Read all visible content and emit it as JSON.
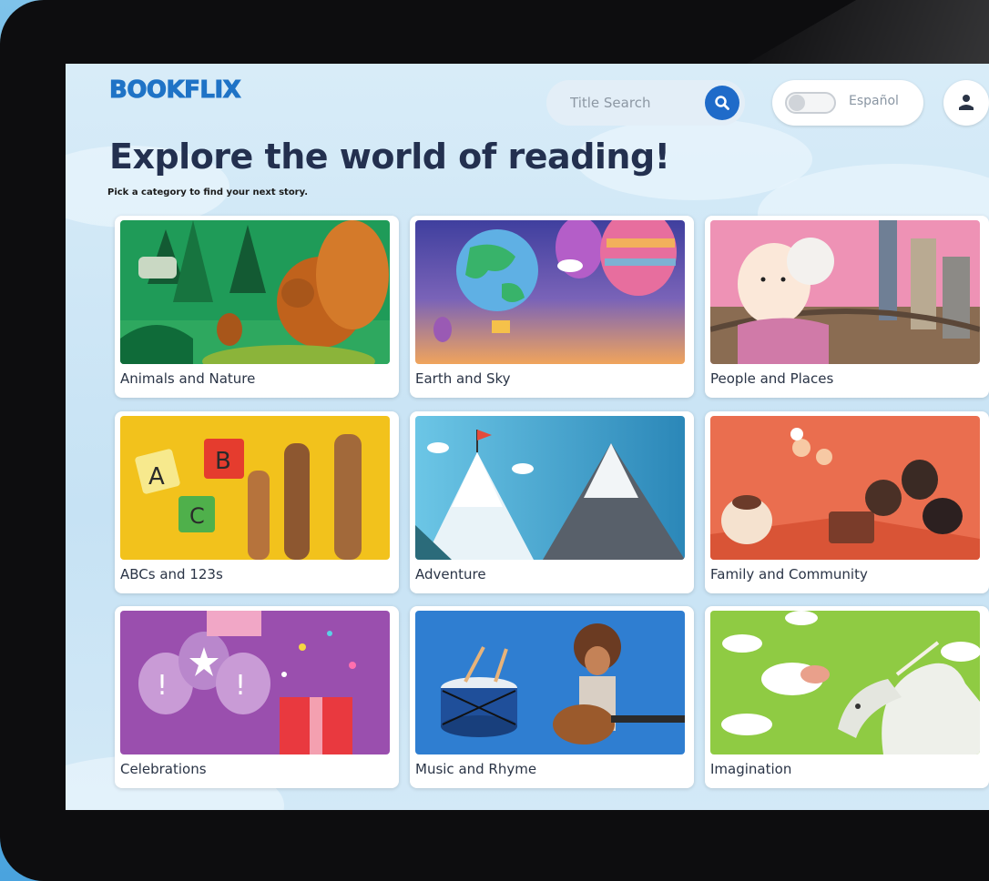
{
  "app": {
    "logo": "BOOKFLIX"
  },
  "header": {
    "search": {
      "placeholder": "Title Search",
      "icon": "search-icon"
    },
    "language_toggle": {
      "label": "Español",
      "state": "off"
    },
    "avatar": {
      "icon": "user-icon"
    }
  },
  "main": {
    "title": "Explore the world of reading!",
    "subtitle": "Pick a category to find your next story."
  },
  "categories": [
    {
      "label": "Animals and Nature"
    },
    {
      "label": "Earth and Sky"
    },
    {
      "label": "People and Places"
    },
    {
      "label": "ABCs and 123s"
    },
    {
      "label": "Adventure"
    },
    {
      "label": "Family and Community"
    },
    {
      "label": "Celebrations"
    },
    {
      "label": "Music and Rhyme"
    },
    {
      "label": "Imagination"
    }
  ],
  "colors": {
    "brand_blue": "#1f73c6",
    "title_navy": "#23304f",
    "search_button": "#1f6bc9"
  }
}
